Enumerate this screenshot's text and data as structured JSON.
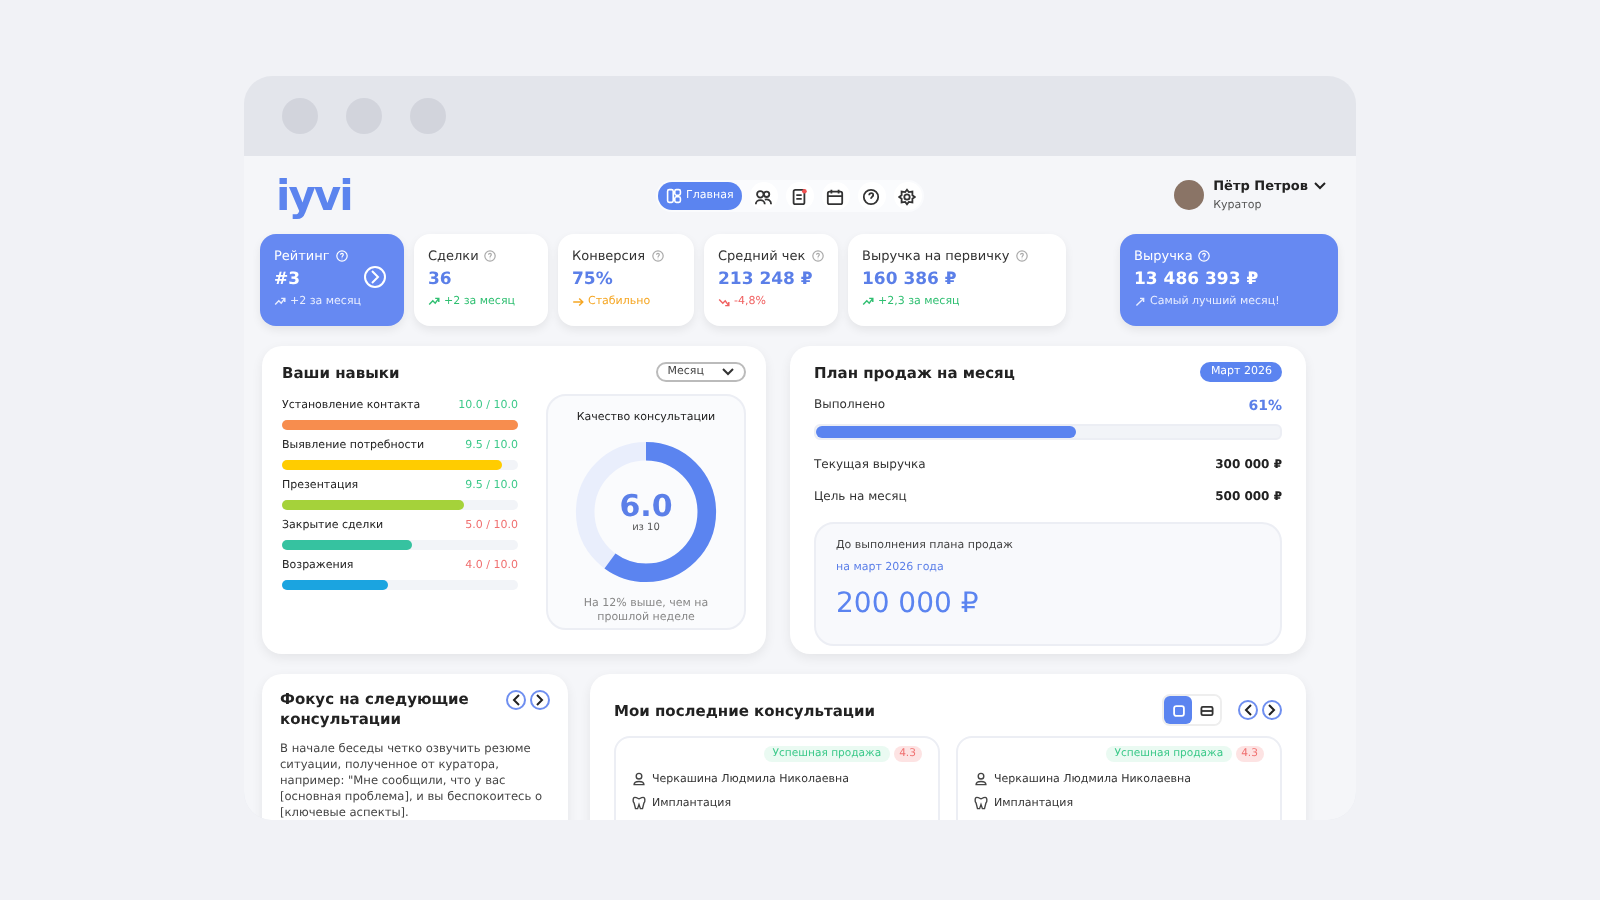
{
  "header": {
    "logo": "iyvi",
    "nav": [
      {
        "label": "Главная",
        "selected": true
      },
      {
        "selected": false
      },
      {
        "selected": false
      },
      {
        "selected": false
      },
      {
        "selected": false
      },
      {
        "selected": false
      }
    ],
    "user": {
      "name": "Пётр Петров",
      "role": "Куратор"
    }
  },
  "kpis": [
    {
      "title": "Рейтинг",
      "value": "#3",
      "trend": {
        "text": "+2 за месяц",
        "kind": "up"
      },
      "highlighted": true,
      "action": true
    },
    {
      "title": "Сделки",
      "value": "36",
      "trend": {
        "text": "+2 за месяц",
        "kind": "up"
      },
      "highlighted": false,
      "action": false
    },
    {
      "title": "Конверсия",
      "value": "75%",
      "trend": {
        "text": "Стабильно",
        "kind": "flat"
      },
      "highlighted": false,
      "action": false
    },
    {
      "title": "Средний чек",
      "value": "213 248 ₽",
      "trend": {
        "text": "-4,8%",
        "kind": "down"
      },
      "highlighted": false,
      "action": false
    },
    {
      "title": "Выручка на первичку",
      "value": "160 386 ₽",
      "trend": {
        "text": "+2,3 за месяц",
        "kind": "up"
      },
      "highlighted": false,
      "action": false
    },
    {
      "title": "Выручка",
      "value": "13 486 393 ₽",
      "trend": {
        "text": "Самый лучший месяц!",
        "kind": "best"
      },
      "highlighted": true,
      "action": false
    }
  ],
  "skills": {
    "title": "Ваши навыки",
    "period": "Месяц",
    "items": [
      {
        "name": "Установление контакта",
        "score": "10.0 / 10.0",
        "low": false,
        "level": 1.0,
        "color": "#f78d4e"
      },
      {
        "name": "Выявление потребности",
        "score": "9.5 / 10.0",
        "low": false,
        "level": 0.93,
        "color": "#ffcc00"
      },
      {
        "name": "Презентация",
        "score": "9.5 / 10.0",
        "low": false,
        "level": 0.77,
        "color": "#a5d23a"
      },
      {
        "name": "Закрытие сделки",
        "score": "5.0 / 10.0",
        "low": true,
        "level": 0.55,
        "color": "#36c2a0"
      },
      {
        "name": "Возражения",
        "score": "4.0 / 10.0",
        "low": true,
        "level": 0.45,
        "color": "#1ba4e0"
      }
    ],
    "quality": {
      "title": "Качество консультации",
      "value": "6.0",
      "scale": "из 10",
      "level": 0.6,
      "note": "На 12% выше, чем на прошлой неделе"
    }
  },
  "plan": {
    "title": "План продаж на месяц",
    "badge": "Март 2026",
    "progress_label": "Выполнено",
    "progress_value": "61%",
    "level": 0.56,
    "rows": [
      {
        "label": "Текущая выручка",
        "value": "300 000 ₽"
      },
      {
        "label": "Цель на месяц",
        "value": "500 000 ₽"
      }
    ],
    "remaining": {
      "caption": "До выполнения плана продаж",
      "period": "на март 2026 года",
      "amount": "200 000 ₽"
    }
  },
  "focus": {
    "title": "Фокус на следующие консультации",
    "text": "В начале беседы четко озвучить резюме ситуации, полученное от куратора, например: \"Мне сообщили, что у вас [основная проблема], и вы беспокоитесь о [ключевые аспекты]."
  },
  "consultations": {
    "title": "Мои последние консультации",
    "views": [
      {
        "selected": true
      },
      {
        "selected": false
      }
    ],
    "items": [
      {
        "status": "Успешная продажа",
        "score": "4.3",
        "client": "Черкашина Людмила Николаевна",
        "service": "Имплантация"
      },
      {
        "status": "Успешная продажа",
        "score": "4.3",
        "client": "Черкашина Людмила Николаевна",
        "service": "Имплантация"
      }
    ]
  }
}
